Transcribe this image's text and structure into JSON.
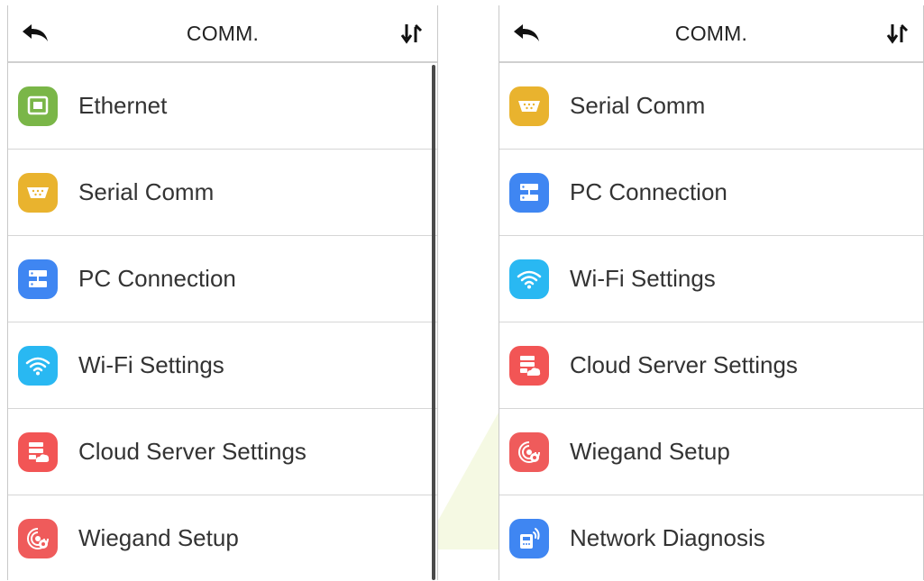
{
  "colors": {
    "ethernet": "#7ab648",
    "serial": "#e9b32e",
    "pc": "#3f86f2",
    "wifi": "#29b8f2",
    "cloud": "#f25555",
    "wiegand": "#ef5b5b",
    "network": "#3f86f2"
  },
  "screens": [
    {
      "title": "COMM.",
      "back_icon": "back-arrow-icon",
      "sort_icon": "sort-arrows-icon",
      "items": [
        {
          "label": "Ethernet",
          "icon": "ethernet-icon"
        },
        {
          "label": "Serial Comm",
          "icon": "serial-port-icon"
        },
        {
          "label": "PC Connection",
          "icon": "pc-connection-icon"
        },
        {
          "label": "Wi-Fi Settings",
          "icon": "wifi-icon"
        },
        {
          "label": "Cloud Server Settings",
          "icon": "cloud-server-icon"
        },
        {
          "label": "Wiegand Setup",
          "icon": "wiegand-icon"
        }
      ]
    },
    {
      "title": "COMM.",
      "back_icon": "back-arrow-icon",
      "sort_icon": "sort-arrows-icon",
      "items": [
        {
          "label": "Serial Comm",
          "icon": "serial-port-icon"
        },
        {
          "label": "PC Connection",
          "icon": "pc-connection-icon"
        },
        {
          "label": "Wi-Fi Settings",
          "icon": "wifi-icon"
        },
        {
          "label": "Cloud Server Settings",
          "icon": "cloud-server-icon"
        },
        {
          "label": "Wiegand Setup",
          "icon": "wiegand-icon"
        },
        {
          "label": "Network Diagnosis",
          "icon": "network-diagnosis-icon"
        }
      ]
    }
  ]
}
